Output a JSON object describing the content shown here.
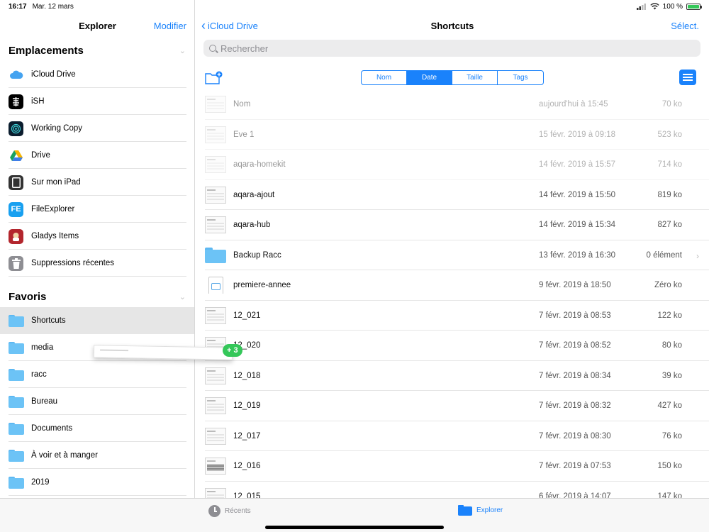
{
  "status": {
    "time": "16:17",
    "date": "Mar. 12 mars",
    "battery": "100 %",
    "battery_level": 1.0
  },
  "sidebar": {
    "title": "Explorer",
    "edit_label": "Modifier",
    "locations_title": "Emplacements",
    "locations": [
      {
        "label": "iCloud Drive",
        "icon": "icloud-icon"
      },
      {
        "label": "iSH",
        "icon": "ish-app-icon"
      },
      {
        "label": "Working Copy",
        "icon": "working-copy-app-icon"
      },
      {
        "label": "Drive",
        "icon": "google-drive-icon"
      },
      {
        "label": "Sur mon iPad",
        "icon": "ipad-icon"
      },
      {
        "label": "FileExplorer",
        "icon": "fileexplorer-app-icon"
      },
      {
        "label": "Gladys Items",
        "icon": "gladys-app-icon"
      },
      {
        "label": "Suppressions récentes",
        "icon": "trash-icon"
      }
    ],
    "favorites_title": "Favoris",
    "favorites": [
      {
        "label": "Shortcuts",
        "active": true
      },
      {
        "label": "media"
      },
      {
        "label": "racc"
      },
      {
        "label": "Bureau"
      },
      {
        "label": "Documents"
      },
      {
        "label": "À voir et à manger"
      },
      {
        "label": "2019"
      }
    ]
  },
  "main": {
    "back_label": "iCloud Drive",
    "title": "Shortcuts",
    "select_label": "Sélect.",
    "search_placeholder": "Rechercher",
    "sort_options": [
      "Nom",
      "Date",
      "Taille",
      "Tags"
    ],
    "sort_selected": "Date",
    "files": [
      {
        "name": "Nom",
        "date": "aujourd'hui à 15:45",
        "size": "70 ko",
        "dim": true,
        "thumb": "file"
      },
      {
        "name": "Eve 1",
        "date": "15 févr. 2019 à 09:18",
        "size": "523 ko",
        "dim": true,
        "thumb": "file"
      },
      {
        "name": "aqara-homekit",
        "date": "14 févr. 2019 à 15:57",
        "size": "714 ko",
        "dim": true,
        "thumb": "file"
      },
      {
        "name": "aqara-ajout",
        "date": "14 févr. 2019 à 15:50",
        "size": "819 ko",
        "thumb": "file"
      },
      {
        "name": "aqara-hub",
        "date": "14 févr. 2019 à 15:34",
        "size": "827 ko",
        "thumb": "file"
      },
      {
        "name": "Backup Racc",
        "date": "13 févr. 2019 à 16:30",
        "size": "0 élément",
        "thumb": "folder"
      },
      {
        "name": "premiere-annee",
        "date": "9 févr. 2019 à 18:50",
        "size": "Zéro ko",
        "thumb": "doc"
      },
      {
        "name": "12_021",
        "date": "7 févr. 2019 à 08:53",
        "size": "122 ko",
        "thumb": "file"
      },
      {
        "name": "12_020",
        "date": "7 févr. 2019 à 08:52",
        "size": "80 ko",
        "thumb": "file"
      },
      {
        "name": "12_018",
        "date": "7 févr. 2019 à 08:34",
        "size": "39 ko",
        "thumb": "file"
      },
      {
        "name": "12_019",
        "date": "7 févr. 2019 à 08:32",
        "size": "427 ko",
        "thumb": "file"
      },
      {
        "name": "12_017",
        "date": "7 févr. 2019 à 08:30",
        "size": "76 ko",
        "thumb": "file"
      },
      {
        "name": "12_016",
        "date": "7 févr. 2019 à 07:53",
        "size": "150 ko",
        "thumb": "dark"
      },
      {
        "name": "12_015",
        "date": "6 févr. 2019 à 14:07",
        "size": "147 ko",
        "thumb": "file"
      }
    ]
  },
  "drag": {
    "badge": "3"
  },
  "tabbar": {
    "recents_label": "Récents",
    "explorer_label": "Explorer"
  },
  "colors": {
    "accent": "#1a82fb",
    "folder": "#6cc3f6",
    "badge_green": "#34c759"
  }
}
